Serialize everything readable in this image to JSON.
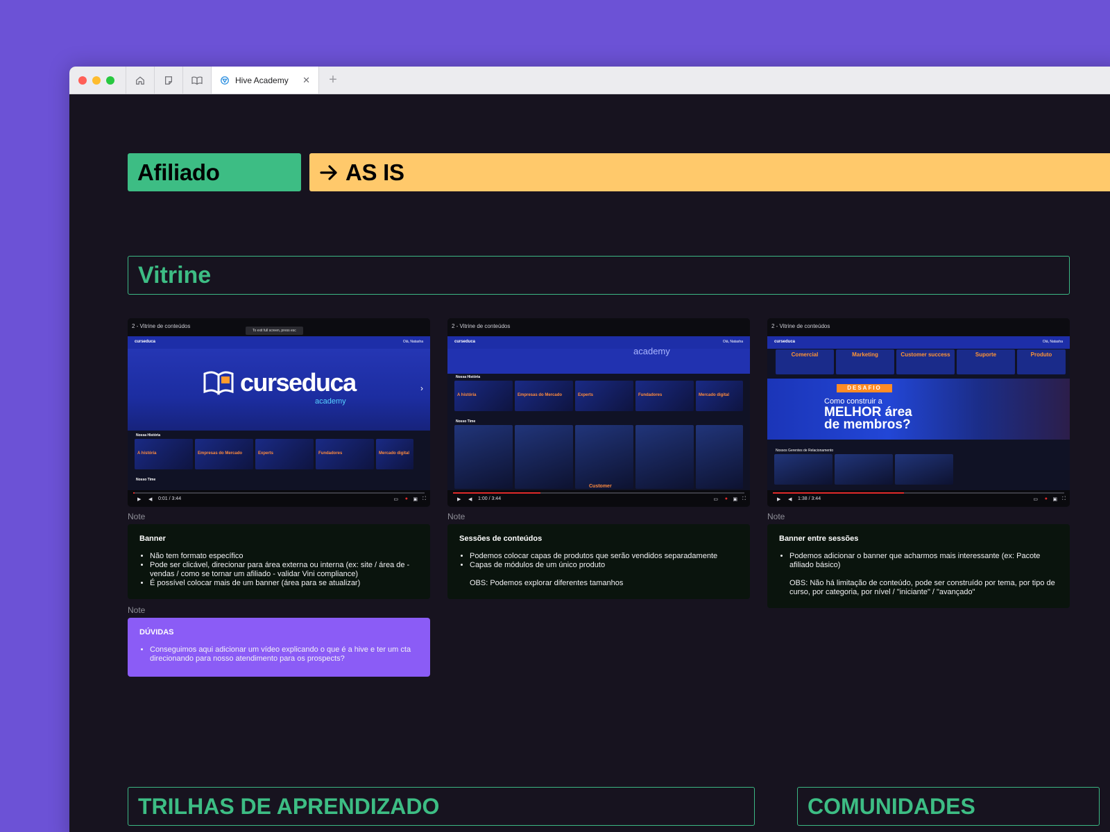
{
  "browser": {
    "tab_title": "Hive Academy",
    "new_tab_symbol": "+",
    "close_symbol": "✕",
    "colors": {
      "close": "#ff5f57",
      "minimize": "#febc2e",
      "zoom": "#28c840"
    }
  },
  "header": {
    "tag_label": "Afiliado",
    "state_label": "AS IS",
    "tag_color": "#3dbd84",
    "state_color": "#ffc96b"
  },
  "sections": {
    "vitrine": "Vitrine",
    "trilhas": "TRILHAS DE APRENDIZADO",
    "comunidades": "COMUNIDADES"
  },
  "screens": [
    {
      "caption": "2 - Vitrine de conteúdos",
      "tooltip": "To exit full screen, press esc",
      "logo": "curseduca",
      "brand": "curseduca",
      "brand_sub": "academy",
      "user": "Olá, Natasha",
      "row1_title": "Nossa História",
      "row1_items": [
        "A história",
        "Empresas do Mercado",
        "Experts",
        "Fundadores",
        "Mercado digital"
      ],
      "row2_title": "Nosso Time",
      "time": "0:01 / 3:44",
      "progress": 0.0
    },
    {
      "caption": "2 - Vitrine de conteúdos",
      "logo": "curseduca",
      "user": "Olá, Natasha",
      "hero_text": "academy",
      "row1_title": "Nossa História",
      "row1_items": [
        "A história",
        "Empresas do Mercado",
        "Experts",
        "Fundadores",
        "Mercado digital"
      ],
      "row2_title": "Nosso Time",
      "row2_caption": "Customer",
      "time": "1:00 / 3:44",
      "progress": 0.3
    },
    {
      "caption": "2 - Vitrine de conteúdos",
      "logo": "curseduca",
      "user": "Olá, Natasha",
      "categories": [
        "Comercial",
        "Marketing",
        "Customer success",
        "Suporte",
        "Produto"
      ],
      "desafio_badge": "DESAFIO",
      "desafio_line1": "Como construir a",
      "desafio_line2": "MELHOR área",
      "desafio_line3": "de membros?",
      "row_title": "Nossos Gerentes de Relacionamento",
      "time": "1:38 / 3:44",
      "progress": 0.45
    }
  ],
  "notes": [
    {
      "label": "Note",
      "title": "Banner",
      "bullets": [
        "Não tem formato específico",
        "Pode ser clicável, direcionar para área externa ou interna (ex: site / área de - vendas / como se tornar um afiliado - validar Vini compliance)",
        "É possível colocar mais de um banner (área para se atualizar)"
      ]
    },
    {
      "label": "Note",
      "title": "Sessões de conteúdos",
      "bullets": [
        "Podemos colocar capas de produtos que serão vendidos separadamente",
        "Capas de módulos de um único produto"
      ],
      "obs": "OBS: Podemos explorar diferentes tamanhos"
    },
    {
      "label": "Note",
      "title": "Banner entre sessões",
      "bullets": [
        "Podemos adicionar o banner que acharmos mais interessante (ex: Pacote afiliado básico)"
      ],
      "obs": "OBS: Não há limitação de conteúdo, pode ser construído por tema, por tipo de curso, por categoria, por nível / \"iniciante\" / \"avançado\""
    },
    {
      "label": "Note",
      "title": "DÚVIDAS",
      "bullets": [
        "Conseguimos aqui adicionar um vídeo explicando o que é a hive  e ter um cta direcionando para nosso atendimento para os prospects?"
      ],
      "color": "#8b5cf6"
    }
  ]
}
